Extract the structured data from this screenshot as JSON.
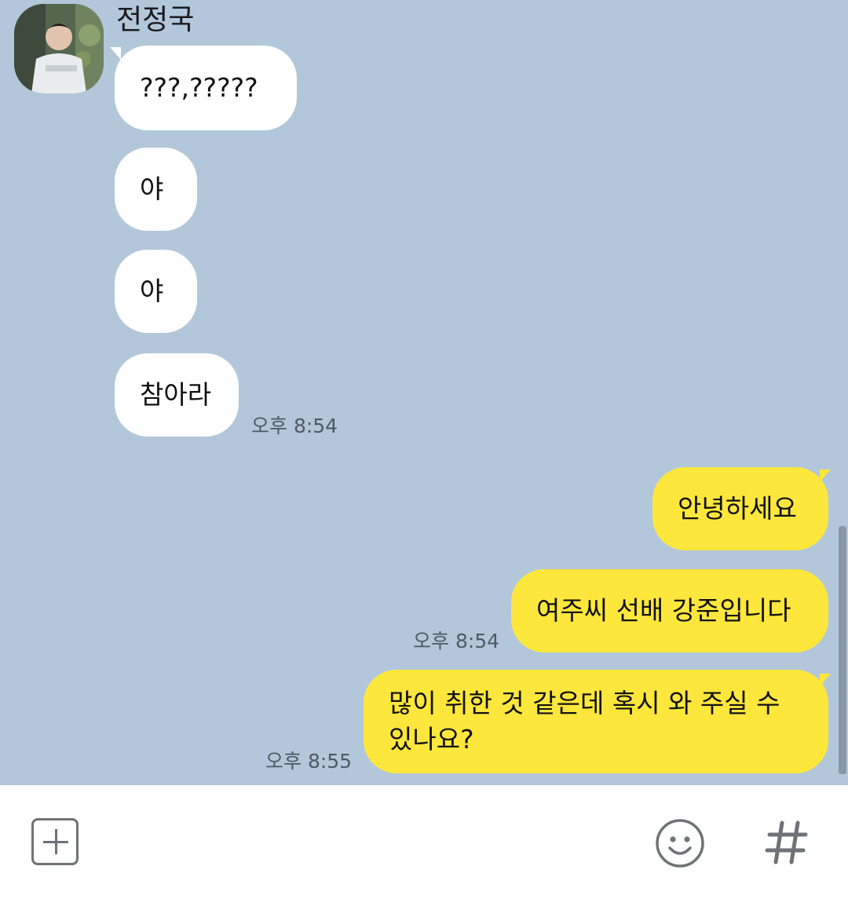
{
  "chat": {
    "sender_name": "전정국",
    "incoming": [
      {
        "text": "???,?????"
      },
      {
        "text": "야"
      },
      {
        "text": "야"
      },
      {
        "text": "참아라"
      }
    ],
    "incoming_time": "오후 8:54",
    "outgoing": [
      {
        "text": "안녕하세요"
      },
      {
        "text": "여주씨 선배 강준입니다"
      },
      {
        "text": "많이 취한 것 같은데 혹시 와 주실 수 있나요?"
      }
    ],
    "outgoing_time_1": "오후 8:54",
    "outgoing_time_2": "오후 8:55"
  },
  "icons": {
    "attach": "plus-square-icon",
    "emoticon": "smiley-face-icon",
    "hashtag": "hash-icon"
  },
  "colors": {
    "chat_background": "#b2c7da",
    "outgoing_bubble": "#fee73c",
    "incoming_bubble": "#ffffff"
  }
}
